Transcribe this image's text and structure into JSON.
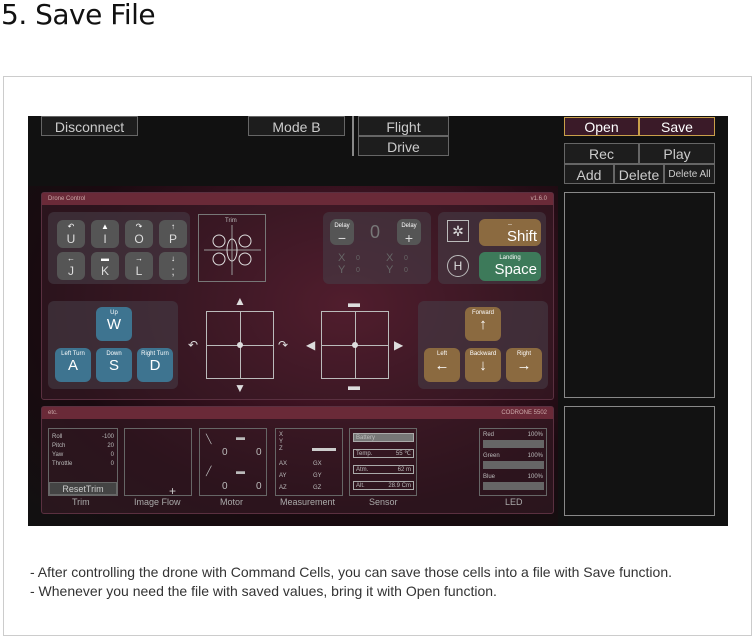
{
  "heading": "5. Save File",
  "topbar": {
    "disconnect": "Disconnect",
    "mode": "Mode B",
    "flight": "Flight",
    "drive": "Drive"
  },
  "files": {
    "open": "Open",
    "save": "Save",
    "rec": "Rec",
    "play": "Play",
    "add": "Add",
    "delete": "Delete",
    "delete_all": "Delete All"
  },
  "drone_panel": {
    "title": "Drone Control",
    "version": "v1.6.0",
    "trim": "Trim",
    "keys_left": [
      "U",
      "I",
      "O",
      "P",
      "J",
      "K",
      "L",
      ";"
    ],
    "delay_label": "Delay",
    "delay_value": "0",
    "minus": "−",
    "plus": "+",
    "xy": [
      "X",
      "0",
      "X",
      "0",
      "Y",
      "0",
      "Y",
      "0"
    ],
    "shift_top": "--",
    "shift": "Shift",
    "landing": "Landing",
    "space": "Space",
    "up": "Up",
    "w": "W",
    "left_turn": "Left Turn",
    "a": "A",
    "down": "Down",
    "s": "S",
    "right_turn": "Right Turn",
    "d": "D",
    "forward": "Forward",
    "left": "Left",
    "backward": "Backward",
    "right": "Right"
  },
  "etc_panel": {
    "title": "etc.",
    "model": "CODRONE 5502",
    "trim_rows": [
      [
        "Roll",
        "-100"
      ],
      [
        "Pitch",
        "20"
      ],
      [
        "Yaw",
        "0"
      ],
      [
        "Throttle",
        "0"
      ]
    ],
    "reset_trim": "ResetTrim",
    "motor_values": [
      "0",
      "0",
      "0",
      "0"
    ],
    "meas_xyz": [
      "X",
      "Y",
      "Z"
    ],
    "meas_labels": [
      "AX",
      "GX",
      "AY",
      "GY",
      "AZ",
      "GZ"
    ],
    "sensor": [
      [
        "Battery",
        ""
      ],
      [
        "Temp.",
        "55 ℃"
      ],
      [
        "Atm.",
        "62 m"
      ],
      [
        "Alt.",
        "28.9 Cm"
      ]
    ],
    "led": [
      [
        "Red",
        "100%"
      ],
      [
        "Green",
        "100%"
      ],
      [
        "Blue",
        "100%"
      ]
    ],
    "section_labels": [
      "Trim",
      "Image Flow",
      "Motor",
      "Measurement",
      "Sensor",
      "LED"
    ]
  },
  "notes": [
    "- After controlling the drone with Command Cells, you can save those cells into a file with Save function.",
    "- Whenever you need the file with saved values, bring it with Open function."
  ]
}
